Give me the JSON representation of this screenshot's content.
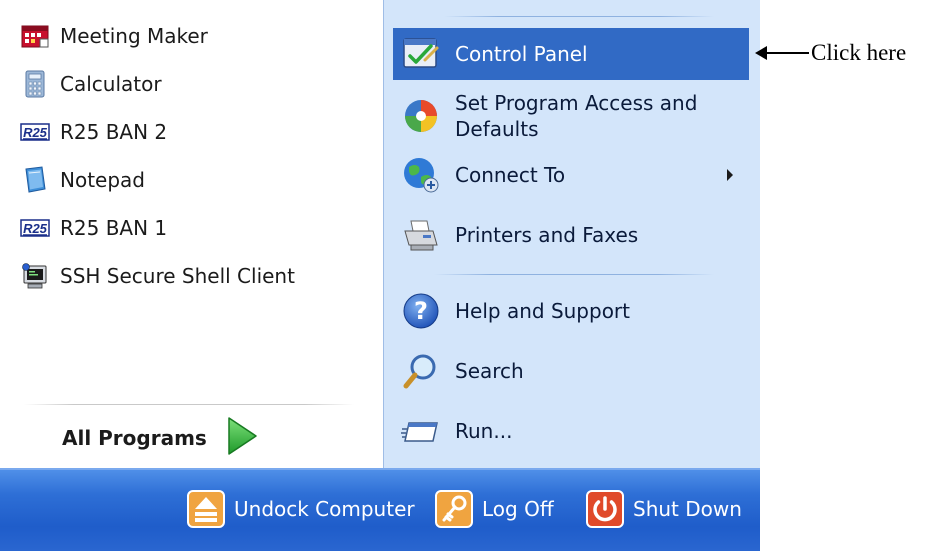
{
  "left_items": [
    {
      "label": "Meeting Maker",
      "icon": "meeting-maker-icon"
    },
    {
      "label": "Calculator",
      "icon": "calculator-icon"
    },
    {
      "label": "R25 BAN 2",
      "icon": "r25-icon"
    },
    {
      "label": "Notepad",
      "icon": "notepad-icon"
    },
    {
      "label": "R25 BAN 1",
      "icon": "r25-icon"
    },
    {
      "label": "SSH Secure Shell Client",
      "icon": "ssh-client-icon"
    }
  ],
  "all_programs": {
    "label": "All Programs",
    "icon": "green-play-arrow-icon"
  },
  "right_items": [
    {
      "label": "Control Panel",
      "icon": "control-panel-icon",
      "selected": true
    },
    {
      "label": "Set Program Access and Defaults",
      "icon": "program-access-icon"
    },
    {
      "label": "Connect To",
      "icon": "globe-connect-icon",
      "submenu": true
    },
    {
      "label": "Printers and Faxes",
      "icon": "printer-icon"
    },
    {
      "label": "Help and Support",
      "icon": "help-icon"
    },
    {
      "label": "Search",
      "icon": "search-icon"
    },
    {
      "label": "Run...",
      "icon": "run-icon"
    }
  ],
  "bottom_buttons": [
    {
      "label": "Undock Computer",
      "icon": "undock-icon"
    },
    {
      "label": "Log Off",
      "icon": "key-icon"
    },
    {
      "label": "Shut Down",
      "icon": "power-icon"
    }
  ],
  "annotation": {
    "text": "Click here"
  },
  "colors": {
    "selection": "#316ac5",
    "right_pane": "#d3e5fa",
    "bottom_bar": "#2e6fd6"
  }
}
